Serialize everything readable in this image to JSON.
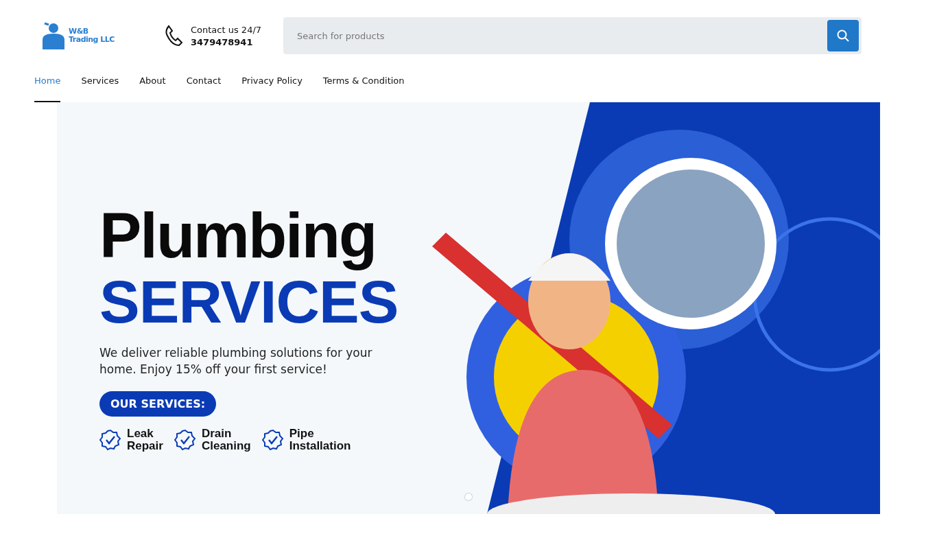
{
  "logo": {
    "line1": "W&B",
    "line2": "Trading LLC"
  },
  "contact": {
    "label": "Contact us 24/7",
    "phone": "3479478941"
  },
  "search": {
    "placeholder": "Search for products"
  },
  "nav": [
    {
      "label": "Home",
      "selected": true
    },
    {
      "label": "Services",
      "selected": false
    },
    {
      "label": "About",
      "selected": false
    },
    {
      "label": "Contact",
      "selected": false
    },
    {
      "label": "Privacy Policy",
      "selected": false
    },
    {
      "label": "Terms & Condition",
      "selected": false
    }
  ],
  "banner": {
    "title": "Plumbing",
    "subtitle": "SERVICES",
    "text": "We deliver reliable plumbing solutions for your home. Enjoy 15% off your first service!",
    "badge": "OUR SERVICES:",
    "services": [
      {
        "line1": "Leak",
        "line2": "Repair"
      },
      {
        "line1": "Drain",
        "line2": "Cleaning"
      },
      {
        "line1": "Pipe",
        "line2": "Installation"
      }
    ]
  },
  "slides": [
    {
      "selected": true
    }
  ]
}
